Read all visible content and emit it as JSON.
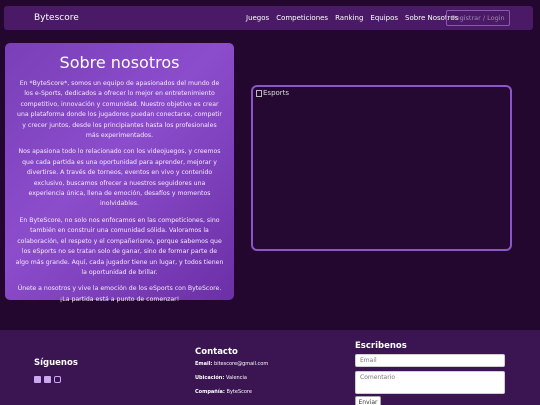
{
  "nav": {
    "brand": "Bytescore",
    "links": [
      "Juegos",
      "Competiciones",
      "Ranking",
      "Equipos",
      "Sobre Nosotros"
    ],
    "login": "Registrar / Login"
  },
  "about": {
    "title": "Sobre nosotros",
    "paragraphs": [
      "En *ByteScore*, somos un equipo de apasionados del mundo de los e-Sports, dedicados a ofrecer lo mejor en entretenimiento competitivo, innovación y comunidad. Nuestro objetivo es crear una plataforma donde los jugadores puedan conectarse, competir y crecer juntos, desde los principiantes hasta los profesionales más experimentados.",
      "Nos apasiona todo lo relacionado con los videojuegos, y creemos que cada partida es una oportunidad para aprender, mejorar y divertirse. A través de torneos, eventos en vivo y contenido exclusivo, buscamos ofrecer a nuestros seguidores una experiencia única, llena de emoción, desafíos y momentos inolvidables.",
      "En ByteScore, no solo nos enfocamos en las competiciones, sino también en construir una comunidad sólida. Valoramos la colaboración, el respeto y el compañerismo, porque sabemos que los eSports no se tratan solo de ganar, sino de formar parte de algo más grande. Aquí, cada jugador tiene un lugar, y todos tienen la oportunidad de brillar.",
      "Únete a nosotros y vive la emoción de los eSports con ByteScore. ¡La partida está a punto de comenzar!"
    ]
  },
  "image": {
    "alt": "Esports"
  },
  "footer": {
    "follow_title": "Síguenos",
    "social_icons": [
      "twitch-icon",
      "twitter-icon",
      "instagram-icon"
    ],
    "contact_title": "Contacto",
    "email_label": "Email:",
    "email_value": "bitescore@gmail.com",
    "location_label": "Ubicación:",
    "location_value": "Valencia",
    "company_label": "Compañía:",
    "company_value": "ByteScore",
    "write_title": "Escribenos",
    "email_placeholder": "Email",
    "comment_placeholder": "Comentario",
    "send_label": "Enviar"
  },
  "colors": {
    "background": "#23072f",
    "navbar": "#4a1a66",
    "card": "#8c4dcc",
    "footer": "#3a1552",
    "frame_border": "#8a56c8"
  }
}
